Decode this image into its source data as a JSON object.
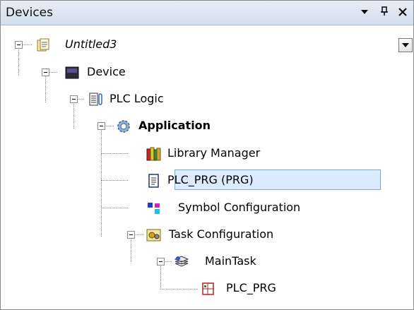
{
  "panel": {
    "title": "Devices"
  },
  "tree": {
    "root": "Untitled3",
    "device": "Device",
    "plc_logic": "PLC Logic",
    "application": "Application",
    "library_manager": "Library Manager",
    "plc_prg": "PLC_PRG (PRG)",
    "symbol_configuration": "Symbol Configuration",
    "task_configuration": "Task Configuration",
    "main_task": "MainTask",
    "main_task_call": "PLC_PRG"
  },
  "colors": {
    "selection_bg": "#dbeaff",
    "selection_border": "#7ea8e0",
    "titlebar": "#d4dfee"
  }
}
